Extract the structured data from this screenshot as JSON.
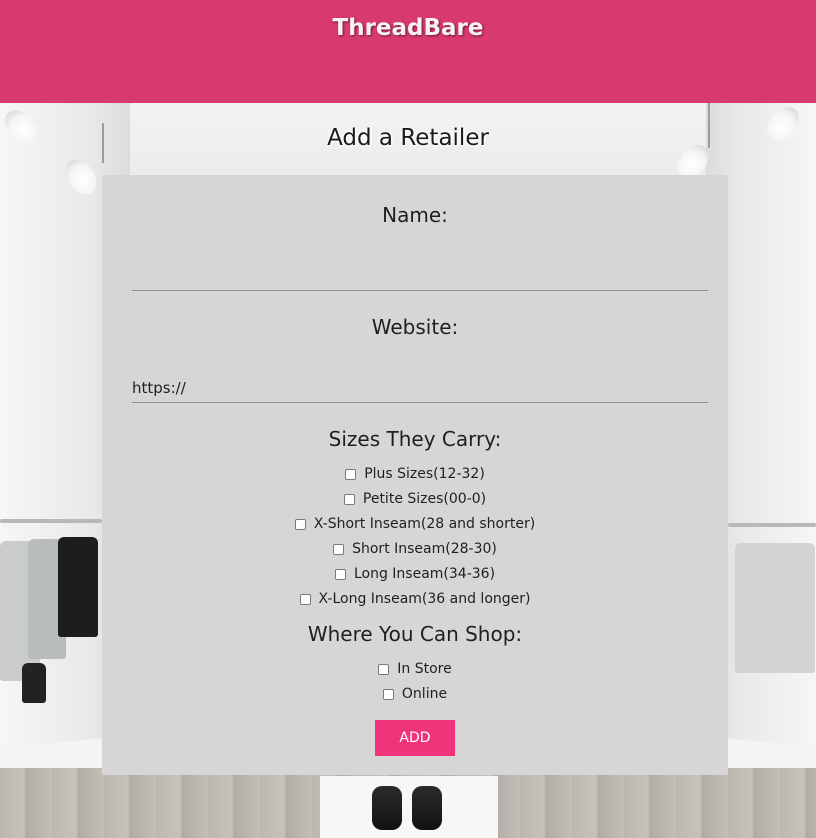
{
  "header": {
    "brand": "ThreadBare",
    "color": "#d93a6d"
  },
  "page": {
    "title": "Add a Retailer"
  },
  "form": {
    "name_label": "Name:",
    "name_value": "",
    "website_label": "Website:",
    "website_value": "https://",
    "sizes_label": "Sizes They Carry:",
    "sizes": [
      {
        "label": "Plus Sizes(12-32)",
        "checked": false
      },
      {
        "label": "Petite Sizes(00-0)",
        "checked": false
      },
      {
        "label": "X-Short Inseam(28 and shorter)",
        "checked": false
      },
      {
        "label": "Short Inseam(28-30)",
        "checked": false
      },
      {
        "label": "Long Inseam(34-36)",
        "checked": false
      },
      {
        "label": "X-Long Inseam(36 and longer)",
        "checked": false
      }
    ],
    "shop_label": "Where You Can Shop:",
    "shop_options": [
      {
        "label": "In Store",
        "checked": false
      },
      {
        "label": "Online",
        "checked": false
      }
    ],
    "submit_label": "ADD",
    "submit_color": "#f0347a"
  }
}
